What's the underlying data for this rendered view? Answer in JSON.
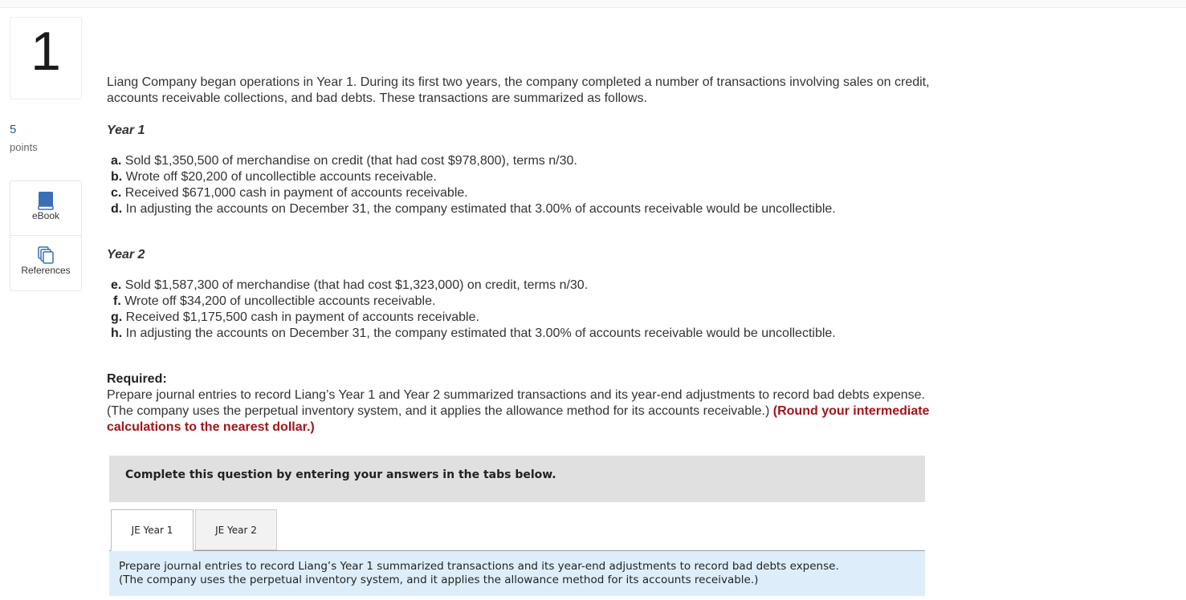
{
  "question": {
    "number": "1",
    "points_value": "5",
    "points_label": "points"
  },
  "tools": [
    {
      "label": "eBook",
      "icon": "book-icon",
      "color": "#3a6fb5"
    },
    {
      "label": "References",
      "icon": "copy-pages-icon",
      "color": "#3a6fb5"
    }
  ],
  "problem": {
    "intro": "Liang Company began operations in Year 1. During its first two years, the company completed a number of transactions involving sales on credit, accounts receivable collections, and bad debts. These transactions are summarized as follows.",
    "year1": {
      "heading": "Year 1",
      "items": [
        {
          "letter": "a.",
          "text": " Sold $1,350,500 of merchandise on credit (that had cost $978,800), terms n/30."
        },
        {
          "letter": "b.",
          "text": " Wrote off $20,200 of uncollectible accounts receivable."
        },
        {
          "letter": "c.",
          "text": " Received $671,000 cash in payment of accounts receivable."
        },
        {
          "letter": "d.",
          "text": " In adjusting the accounts on December 31, the company estimated that 3.00% of accounts receivable would be uncollectible."
        }
      ]
    },
    "year2": {
      "heading": "Year 2",
      "items": [
        {
          "letter": "e.",
          "text": " Sold $1,587,300 of merchandise (that had cost $1,323,000) on credit, terms n/30."
        },
        {
          "letter": "f.",
          "text": " Wrote off $34,200 of uncollectible accounts receivable."
        },
        {
          "letter": "g.",
          "text": " Received $1,175,500 cash in payment of accounts receivable."
        },
        {
          "letter": "h.",
          "text": " In adjusting the accounts on December 31, the company estimated that 3.00% of accounts receivable would be uncollectible."
        }
      ]
    },
    "required": {
      "title": "Required:",
      "text": "Prepare journal entries to record Liang’s Year 1 and Year 2 summarized transactions and its year-end adjustments to record bad debts expense. (The company uses the perpetual inventory system, and it applies the allowance method for its accounts receivable.) ",
      "emphasis": "(Round your intermediate calculations to the nearest dollar.)",
      "emphasis_color": "#a3141c"
    }
  },
  "answer_panel": {
    "header": "Complete this question by entering your answers in the tabs below.",
    "tabs": [
      {
        "label": "JE Year 1",
        "active": true
      },
      {
        "label": "JE Year 2",
        "active": false
      }
    ],
    "instruction": "Prepare journal entries to record Liang’s Year 1 summarized transactions and its year-end adjustments to record bad debts expense.\n(The company uses the perpetual inventory system, and it applies the allowance method for its accounts receivable.)"
  }
}
